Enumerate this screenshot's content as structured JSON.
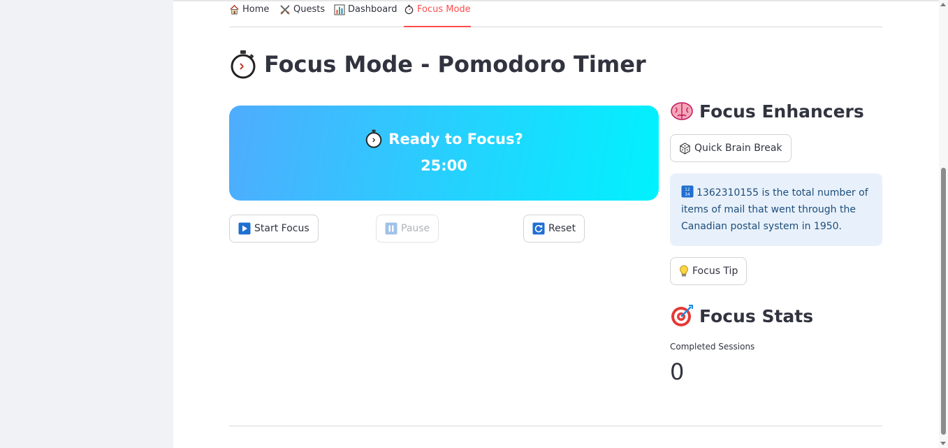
{
  "nav": {
    "tabs": [
      {
        "label": "Home",
        "icon": "home-icon"
      },
      {
        "label": "Quests",
        "icon": "crossed-swords-icon"
      },
      {
        "label": "Dashboard",
        "icon": "bar-chart-icon"
      },
      {
        "label": "Focus Mode",
        "icon": "stopwatch-icon",
        "active": true
      }
    ]
  },
  "page": {
    "title": "Focus Mode - Pomodoro Timer"
  },
  "timer": {
    "heading": "Ready to Focus?",
    "time": "25:00"
  },
  "controls": {
    "start_label": "Start Focus",
    "pause_label": "Pause",
    "reset_label": "Reset"
  },
  "enhancers": {
    "heading": "Focus Enhancers",
    "brain_break_label": "Quick Brain Break",
    "fact_text": "1362310155 is the total number of items of mail that went through the Canadian postal system in 1950.",
    "focus_tip_label": "Focus Tip"
  },
  "stats": {
    "heading": "Focus Stats",
    "completed_label": "Completed Sessions",
    "completed_value": "0"
  },
  "colors": {
    "accent": "#ff4b4b",
    "gradient_start": "#4facfe",
    "gradient_end": "#00f2fe",
    "info_bg": "#e8f1fb",
    "info_text": "#1e4d7b"
  }
}
